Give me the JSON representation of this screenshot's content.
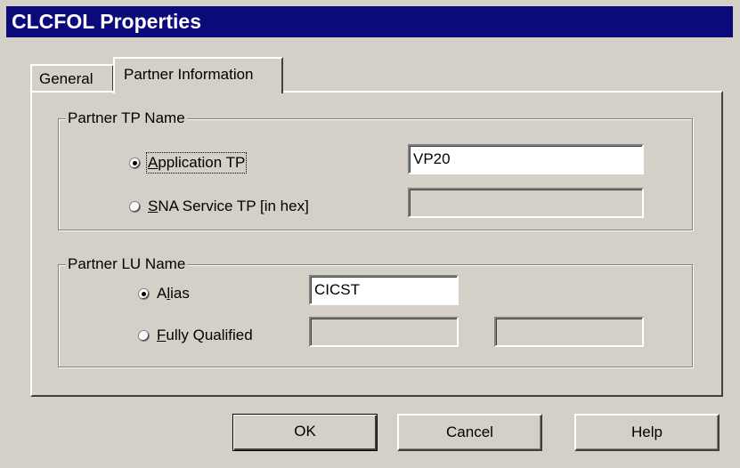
{
  "window": {
    "title": "CLCFOL Properties"
  },
  "tabs": [
    {
      "label": "General",
      "active": false
    },
    {
      "label": "Partner Information",
      "active": true
    }
  ],
  "partner_tp": {
    "legend": "Partner TP Name",
    "application_tp": {
      "access_key": "A",
      "label_rest": "pplication TP",
      "checked": true,
      "value": "VP20"
    },
    "sna_service_tp": {
      "access_key": "S",
      "label_rest": "NA Service TP [in hex]",
      "checked": false,
      "value": ""
    }
  },
  "partner_lu": {
    "legend": "Partner LU Name",
    "alias": {
      "label_pre": "A",
      "access_key": "l",
      "label_rest": "ias",
      "checked": true,
      "value": "CICST"
    },
    "fully_qualified": {
      "access_key": "F",
      "label_rest": "ully Qualified",
      "checked": false,
      "value1": "",
      "value2": ""
    }
  },
  "buttons": {
    "ok": "OK",
    "cancel": "Cancel",
    "help": "Help"
  }
}
